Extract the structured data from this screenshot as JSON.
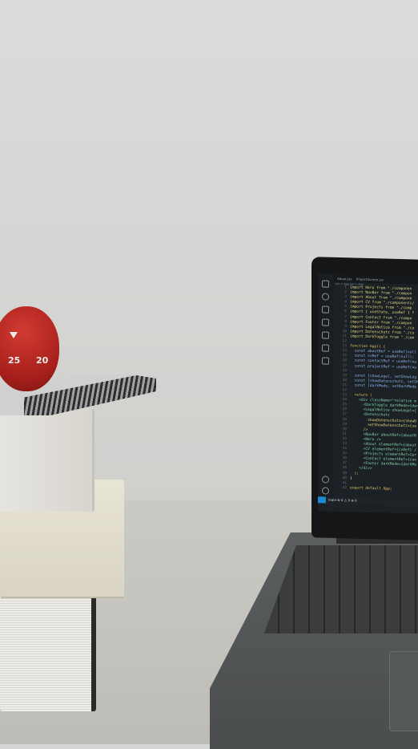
{
  "scene": "desk with laptop, books and tomato timer",
  "timer": {
    "label_a": "25",
    "label_b": "20",
    "color": "#b3241f"
  },
  "editor": {
    "tabs": [
      "About.jsx",
      "ProjectScreen.jsx"
    ],
    "breadcrumb": "src > App.jsx > App",
    "status": "main  ⊗ 0 ⚠ 0   ⊕ 0",
    "lines": [
      "import Hero from \"./componen",
      "import NavBar from \"./compon",
      "import About from \"./compone",
      "import CV from \"./components/",
      "import Projects from \"./comp",
      "import { useState, useRef } f",
      "import Contact from \"./compo",
      "import Footer from \"./compon",
      "import LegalNotice from \"./co",
      "import Datenschutz from \"./co",
      "import DarkToggle from \"./com",
      "",
      "function App() {",
      "  const aboutRef = useRef(null",
      "  const cvRef = useRef(null);",
      "  const contactRef = useRef(nu",
      "  const projectRef = useRef(nu",
      "",
      "  const [showLegal, setShowLeg",
      "  const [showDatenschutz, setSh",
      "  const [darkMode, setDarkMode",
      "",
      "  return (",
      "    <div className=\"relative m",
      "      <DarkToggle darkMode={dar",
      "      <LegalNotice showLegal={",
      "      <Datenschutz",
      "        showDatenschutz={showD",
      "        setShowDatenschutz={se",
      "      />",
      "      <NavBar aboutRef={aboutR",
      "      <Hero />",
      "      <About elementRef={about",
      "      <CV elementRef={cvRef} /",
      "      <Projects elementRef={pr",
      "      <Contact elementRef={con",
      "      <Footer darkMode={darkMo",
      "    </div>",
      "  );",
      "}",
      "",
      "export default App;"
    ]
  }
}
